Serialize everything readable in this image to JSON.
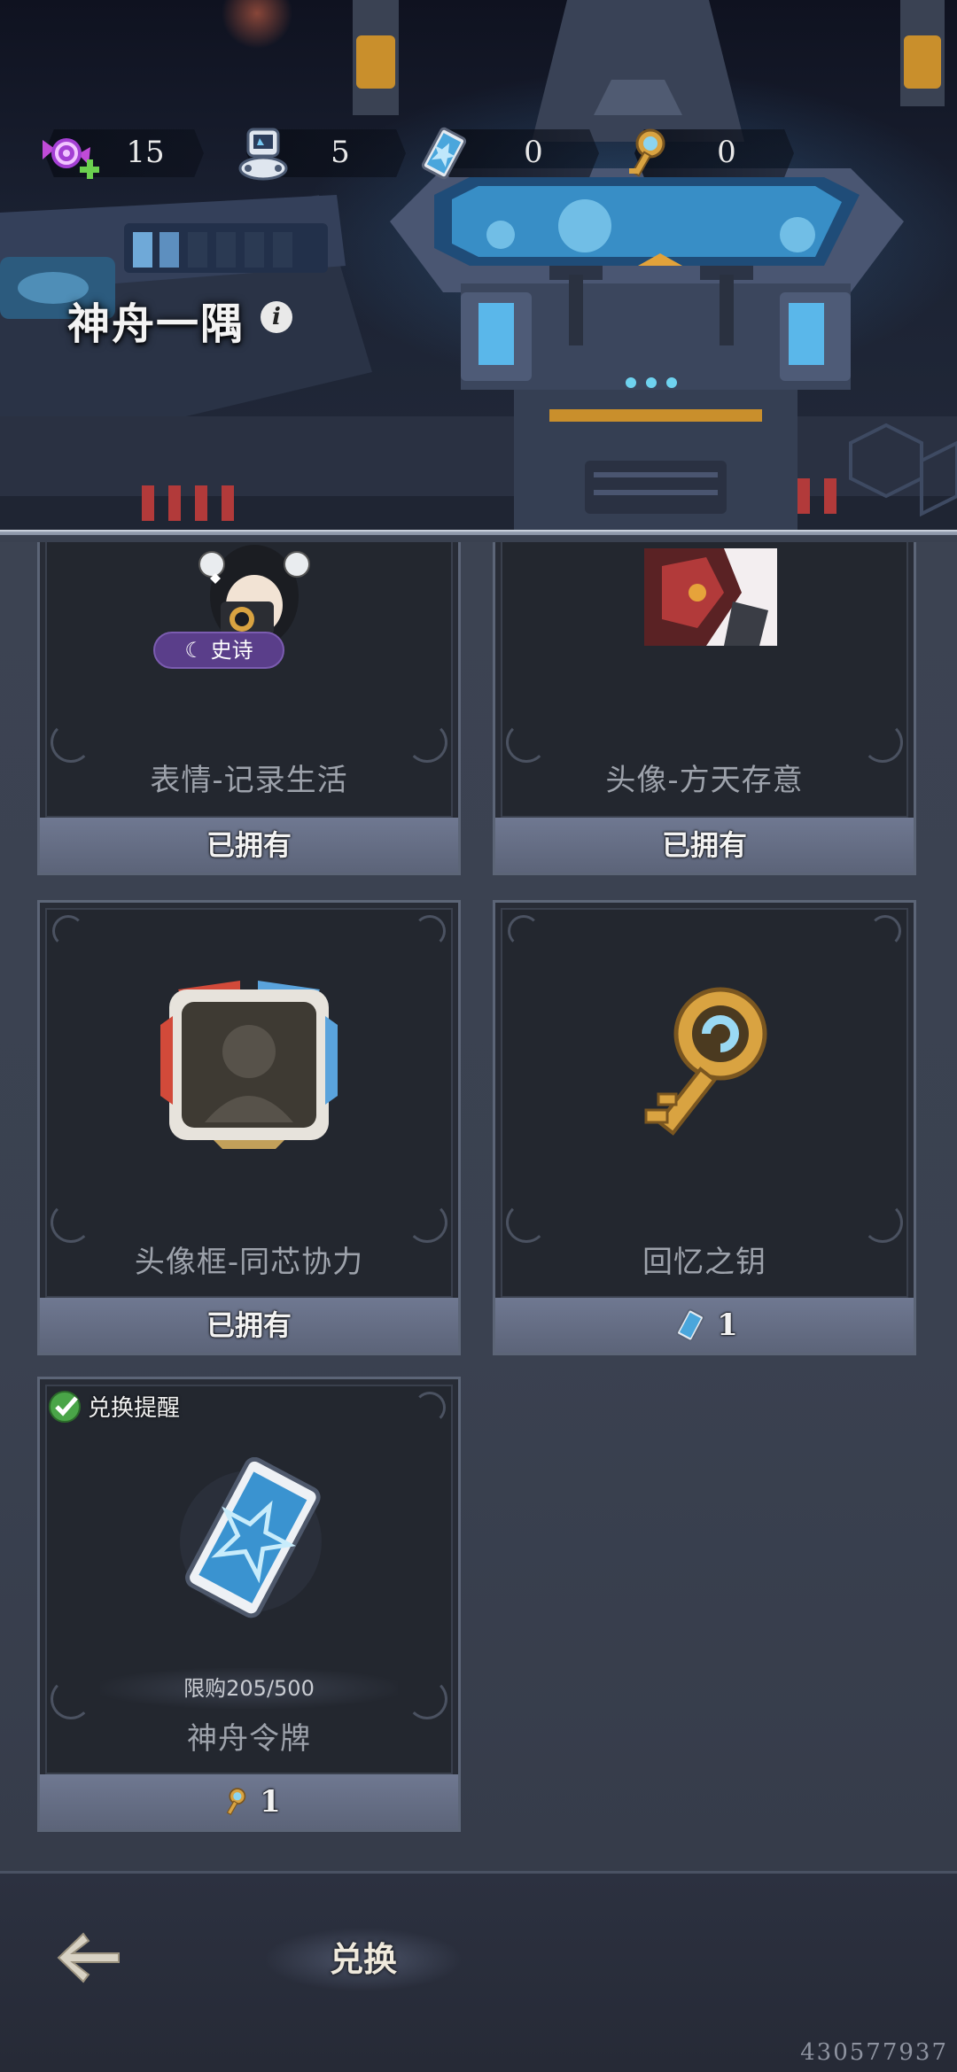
{
  "header": {
    "title": "神舟一隅",
    "currencies": [
      {
        "icon": "candy-icon",
        "value": "15",
        "addable": true
      },
      {
        "icon": "robot-icon",
        "value": "5"
      },
      {
        "icon": "card-token-icon",
        "value": "0"
      },
      {
        "icon": "key-icon",
        "value": "0"
      }
    ]
  },
  "items": [
    {
      "name": "表情-记录生活",
      "rarity": "史诗",
      "status": "已拥有",
      "icon": "camera-girl-emote-icon"
    },
    {
      "name": "头像-方天存意",
      "status": "已拥有",
      "icon": "mech-avatar-icon"
    },
    {
      "name": "头像框-同芯协力",
      "status": "已拥有",
      "icon": "avatar-frame-icon"
    },
    {
      "name": "回忆之钥",
      "cost": "1",
      "cost_icon": "card-token-icon",
      "icon": "memory-key-icon"
    },
    {
      "name": "神舟令牌",
      "cost": "1",
      "cost_icon": "key-icon",
      "icon": "shenzhou-token-icon",
      "remind_label": "兑换提醒",
      "limit_text": "限购205/500"
    }
  ],
  "bottom": {
    "tab_label": "兑换"
  },
  "uid": "430577937",
  "colors": {
    "footer": "#6f7891",
    "card_bg": "#23272f",
    "rarity_epic": "#5a3e8a"
  }
}
